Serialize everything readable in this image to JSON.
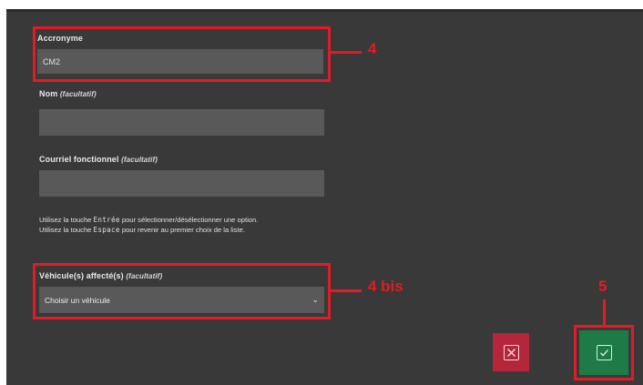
{
  "form": {
    "acronym": {
      "label": "Accronyme",
      "value": "CM2"
    },
    "name": {
      "label": "Nom",
      "optional": "(facultatif)",
      "value": ""
    },
    "email": {
      "label": "Courriel fonctionnel",
      "optional": "(facultatif)",
      "value": ""
    },
    "hint": {
      "line1_pre": "Utilisez la touche ",
      "line1_key": "Entrée",
      "line1_post": " pour sélectionner/désélectionner une option.",
      "line2_pre": "Utilisez la touche ",
      "line2_key": "Espace",
      "line2_post": " pour revenir au premier choix de la liste."
    },
    "vehicle": {
      "label": "Véhicule(s) affecté(s)",
      "optional": "(facultatif)",
      "selected": "Choisir un véhicule"
    }
  },
  "annotations": {
    "a4": "4",
    "a4bis": "4 bis",
    "a5": "5"
  },
  "buttons": {
    "cancel_icon": "close-icon",
    "confirm_icon": "check-icon"
  },
  "colors": {
    "panel": "#393939",
    "field": "#595959",
    "annotation": "#e31b23",
    "cancel": "#b5263a",
    "confirm": "#1e7a47"
  }
}
